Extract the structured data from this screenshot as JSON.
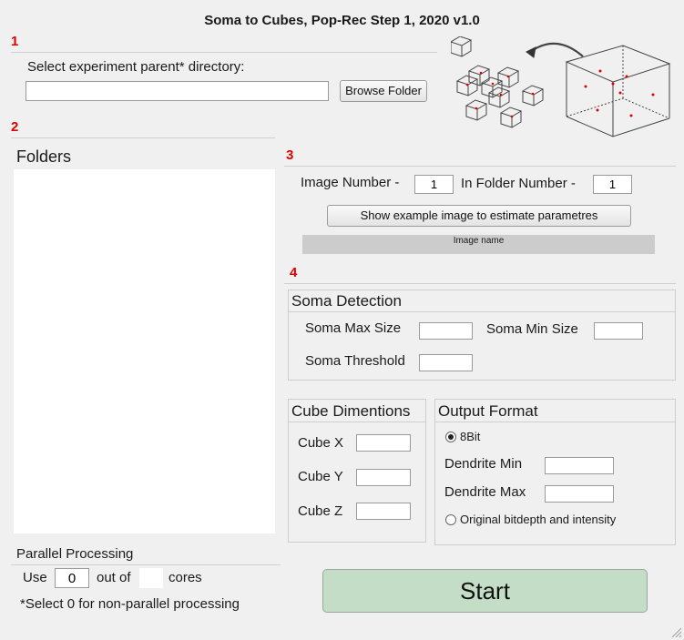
{
  "app": {
    "title": "Soma to Cubes, Pop-Rec Step 1, 2020 v1.0"
  },
  "steps": {
    "s1": "1",
    "s2": "2",
    "s3": "3",
    "s4": "4"
  },
  "section1": {
    "prompt": "Select experiment parent* directory:",
    "path_value": "",
    "browse_label": "Browse Folder"
  },
  "folders": {
    "title": "Folders",
    "items": []
  },
  "section3": {
    "image_number_label": "Image Number -",
    "image_number_value": "1",
    "in_folder_label": "In Folder Number -",
    "in_folder_value": "1",
    "show_example_label": "Show example image to estimate parametres",
    "image_name": "Image name"
  },
  "soma": {
    "title": "Soma Detection",
    "max_label": "Soma Max Size",
    "max_value": "",
    "min_label": "Soma Min Size",
    "min_value": "",
    "threshold_label": "Soma Threshold",
    "threshold_value": ""
  },
  "cube": {
    "title": "Cube Dimentions",
    "x_label": "Cube X",
    "x_value": "",
    "y_label": "Cube Y",
    "y_value": "",
    "z_label": "Cube Z",
    "z_value": ""
  },
  "output": {
    "title": "Output Format",
    "opt_8bit": "8Bit",
    "opt_8bit_selected": true,
    "dendrite_min_label": "Dendrite Min",
    "dendrite_min_value": "",
    "dendrite_max_label": "Dendrite Max",
    "dendrite_max_value": "",
    "opt_original": "Original bitdepth and intensity",
    "opt_original_selected": false
  },
  "parallel": {
    "title": "Parallel Processing",
    "use_label": "Use",
    "use_value": "0",
    "out_of_label": "out of",
    "cores_value": "",
    "cores_label": "cores",
    "note": "*Select 0 for non-parallel processing"
  },
  "start": {
    "label": "Start"
  },
  "colors": {
    "accent_red": "#e00000",
    "start_green": "#c3ddc6",
    "image_name_bar": "#cccccc"
  },
  "icons": {
    "illustration": "cube-split-illustration-icon",
    "resize": "resize-grip-icon"
  }
}
